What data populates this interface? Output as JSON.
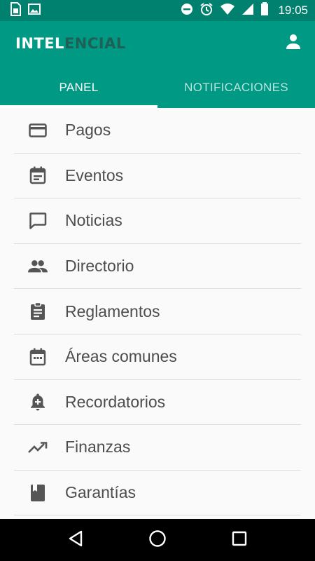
{
  "status_bar": {
    "time": "19:05",
    "icons": [
      "sim-card-icon",
      "image-icon",
      "do-not-disturb-icon",
      "alarm-icon",
      "wifi-icon",
      "signal-icon",
      "battery-icon"
    ]
  },
  "app": {
    "logo_part_a": "INTEL",
    "logo_part_b": "ENCIAL",
    "colors": {
      "primary": "#009a84",
      "status_bar": "#00806e",
      "logo_dark": "#1e5f56"
    }
  },
  "tabs": [
    {
      "label": "PANEL",
      "active": true
    },
    {
      "label": "NOTIFICACIONES",
      "active": false
    }
  ],
  "menu": [
    {
      "label": "Pagos",
      "icon": "credit-card-icon"
    },
    {
      "label": "Eventos",
      "icon": "calendar-icon"
    },
    {
      "label": "Noticias",
      "icon": "chat-bubble-icon"
    },
    {
      "label": "Directorio",
      "icon": "people-icon"
    },
    {
      "label": "Reglamentos",
      "icon": "clipboard-icon"
    },
    {
      "label": "Áreas comunes",
      "icon": "calendar-dots-icon"
    },
    {
      "label": "Recordatorios",
      "icon": "bell-add-icon"
    },
    {
      "label": "Finanzas",
      "icon": "trending-up-icon"
    },
    {
      "label": "Garantías",
      "icon": "book-icon"
    }
  ],
  "nav_bar": {
    "buttons": [
      "back-icon",
      "home-icon",
      "recents-icon"
    ]
  }
}
